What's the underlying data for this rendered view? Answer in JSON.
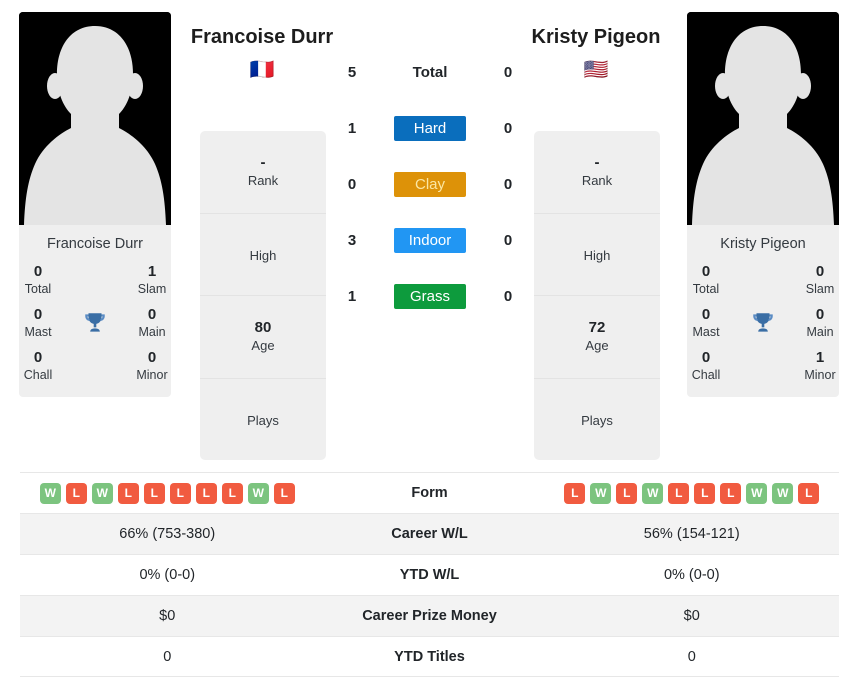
{
  "colors": {
    "hard": "#0a6ebd",
    "clay": "#dd9208",
    "clay_text": "#fbe6a2",
    "indoor": "#2196f3",
    "grass": "#0d9b3d",
    "win": "#7cc47f",
    "loss": "#f15b40",
    "trophy": "#3a6ea5",
    "avatar_bg": "#000000",
    "panel_bg": "#efefef",
    "stripe_bg": "#f3f3f3"
  },
  "players": {
    "left": {
      "name": "Francoise Durr",
      "flag": "🇫🇷",
      "avatar_name": "player-avatar-silhouette",
      "card_name": "Francoise Durr",
      "titles": [
        {
          "value": "0",
          "label": "Total"
        },
        {
          "value": "1",
          "label": "Slam"
        },
        {
          "value": "0",
          "label": "Mast"
        },
        {
          "value": "0",
          "label": "Main"
        },
        {
          "value": "0",
          "label": "Chall"
        },
        {
          "value": "0",
          "label": "Minor"
        }
      ],
      "stats": [
        {
          "value": "-",
          "label": "Rank"
        },
        {
          "value": "",
          "label": "High"
        },
        {
          "value": "80",
          "label": "Age"
        },
        {
          "value": "",
          "label": "Plays"
        }
      ],
      "form": [
        "W",
        "L",
        "W",
        "L",
        "L",
        "L",
        "L",
        "L",
        "W",
        "L"
      ],
      "career_wl": "66% (753-380)",
      "ytd_wl": "0% (0-0)",
      "career_prize_money": "$0",
      "ytd_titles": "0"
    },
    "right": {
      "name": "Kristy Pigeon",
      "flag": "🇺🇸",
      "avatar_name": "player-avatar-silhouette",
      "card_name": "Kristy Pigeon",
      "titles": [
        {
          "value": "0",
          "label": "Total"
        },
        {
          "value": "0",
          "label": "Slam"
        },
        {
          "value": "0",
          "label": "Mast"
        },
        {
          "value": "0",
          "label": "Main"
        },
        {
          "value": "0",
          "label": "Chall"
        },
        {
          "value": "1",
          "label": "Minor"
        }
      ],
      "stats": [
        {
          "value": "-",
          "label": "Rank"
        },
        {
          "value": "",
          "label": "High"
        },
        {
          "value": "72",
          "label": "Age"
        },
        {
          "value": "",
          "label": "Plays"
        }
      ],
      "form": [
        "L",
        "W",
        "L",
        "W",
        "L",
        "L",
        "L",
        "W",
        "W",
        "L"
      ],
      "career_wl": "56% (154-121)",
      "ytd_wl": "0% (0-0)",
      "career_prize_money": "$0",
      "ytd_titles": "0"
    }
  },
  "surfaces": [
    {
      "label": "Total",
      "left": "5",
      "right": "0",
      "badge": false
    },
    {
      "label": "Hard",
      "left": "1",
      "right": "0",
      "badge": true
    },
    {
      "label": "Clay",
      "left": "0",
      "right": "0",
      "badge": true
    },
    {
      "label": "Indoor",
      "left": "3",
      "right": "0",
      "badge": true
    },
    {
      "label": "Grass",
      "left": "1",
      "right": "0",
      "badge": true
    }
  ],
  "table": {
    "rows": [
      {
        "label": "Form"
      },
      {
        "label": "Career W/L"
      },
      {
        "label": "YTD W/L"
      },
      {
        "label": "Career Prize Money"
      },
      {
        "label": "YTD Titles"
      }
    ]
  }
}
